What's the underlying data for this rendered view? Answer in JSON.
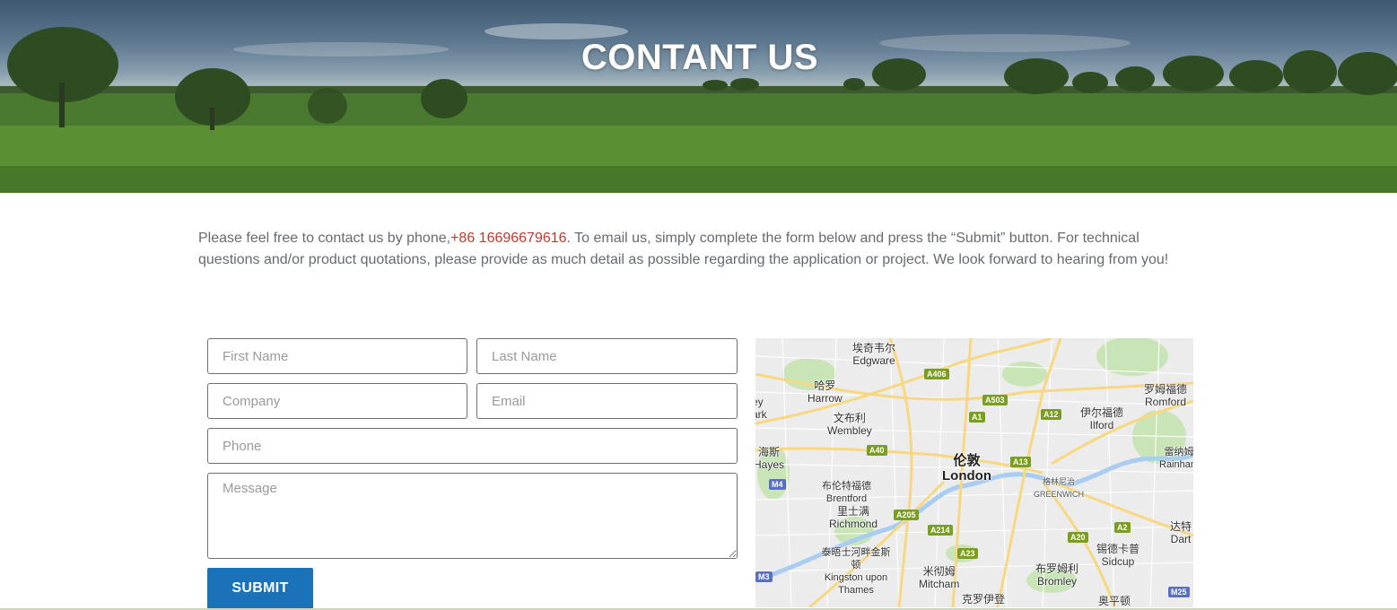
{
  "hero": {
    "title": "CONTANT US"
  },
  "intro": {
    "before_phone": "Please feel free to contact us by phone,",
    "phone": "+86 16696679616",
    "after_phone": ". To email us, simply complete the form below and press the “Submit” button. For technical questions and/or product quotations, please provide as much detail as possible regarding the application or project. We look forward to hearing from you!"
  },
  "form": {
    "first_name_placeholder": "First Name",
    "last_name_placeholder": "Last Name",
    "company_placeholder": "Company",
    "email_placeholder": "Email",
    "phone_placeholder": "Phone",
    "message_placeholder": "Message",
    "submit_label": "SUBMIT"
  },
  "map": {
    "places": [
      {
        "zh": "埃奇韦尔",
        "en": "Edgware"
      },
      {
        "zh": "哈罗",
        "en": "Harrow"
      },
      {
        "zh": "文布利",
        "en": "Wembley"
      },
      {
        "zh": "海斯",
        "en": "Hayes"
      },
      {
        "zh": "布伦特福德",
        "en": "Brentford"
      },
      {
        "zh": "里士满",
        "en": "Richmond"
      },
      {
        "zh": "泰晤士河畔金斯顿",
        "en": "Kingston upon Thames"
      },
      {
        "zh": "米彻姆",
        "en": "Mitcham"
      },
      {
        "zh": "克罗伊登",
        "en": ""
      },
      {
        "zh": "伦敦",
        "en": "London"
      },
      {
        "zh": "格林尼治",
        "en": "GREENWICH"
      },
      {
        "zh": "伊尔福德",
        "en": "Ilford"
      },
      {
        "zh": "罗姆福德",
        "en": "Romford"
      },
      {
        "zh": "雷纳姆",
        "en": "Rainham"
      },
      {
        "zh": "达特",
        "en": "Dart"
      },
      {
        "zh": "锡德卡普",
        "en": "Sidcup"
      },
      {
        "zh": "布罗姆利",
        "en": "Bromley"
      },
      {
        "zh": "奥平顿",
        "en": ""
      }
    ],
    "partial_labels": {
      "left_ey": "ey",
      "left_ark": "ark"
    },
    "roads": [
      "A406",
      "A503",
      "A1",
      "A12",
      "A40",
      "A13",
      "M4",
      "A205",
      "A214",
      "A2",
      "A20",
      "A23",
      "M3",
      "M25"
    ]
  }
}
